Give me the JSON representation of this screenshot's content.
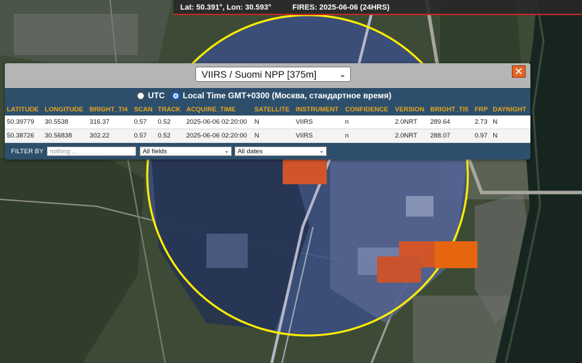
{
  "topbar": {
    "coords": "Lat: 50.391°, Lon: 30.593°",
    "fires": "FIRES: 2025-06-06 (24HRS)"
  },
  "popup": {
    "satellite_selected": "VIIRS / Suomi NPP [375m]",
    "close_label": "✕",
    "time_options": {
      "utc_label": "UTC",
      "local_label": "Local Time GMT+0300 (Москва, стандартное время)",
      "selected": "local"
    },
    "table": {
      "headers": [
        "LATITUDE",
        "LONGITUDE",
        "BRIGHT_TI4",
        "SCAN",
        "TRACK",
        "ACQUIRE_TIME",
        "SATELLITE",
        "INSTRUMENT",
        "CONFIDENCE",
        "VERSION",
        "BRIGHT_TI5",
        "FRP",
        "DAYNIGHT"
      ],
      "rows": [
        [
          "50.39779",
          "30.5538",
          "316.37",
          "0.57",
          "0.52",
          "2025-06-06 02:20:00",
          "N",
          "VIIRS",
          "n",
          "2.0NRT",
          "289.64",
          "2.73",
          "N"
        ],
        [
          "50.38726",
          "30.56838",
          "302.22",
          "0.57",
          "0.52",
          "2025-06-06 02:20:00",
          "N",
          "VIIRS",
          "n",
          "2.0NRT",
          "288.07",
          "0.97",
          "N"
        ]
      ]
    },
    "filter": {
      "label": "FILTER BY",
      "placeholder": "nothing ...",
      "field_select": "All fields",
      "date_select": "All dates"
    }
  },
  "colors": {
    "circle": "#ffee00",
    "fire_hotspot": "#d2552a",
    "fire_hotspot_bright": "#e8650f",
    "popup_bg": "#2d4f6c",
    "header_text": "#e8a51c"
  }
}
